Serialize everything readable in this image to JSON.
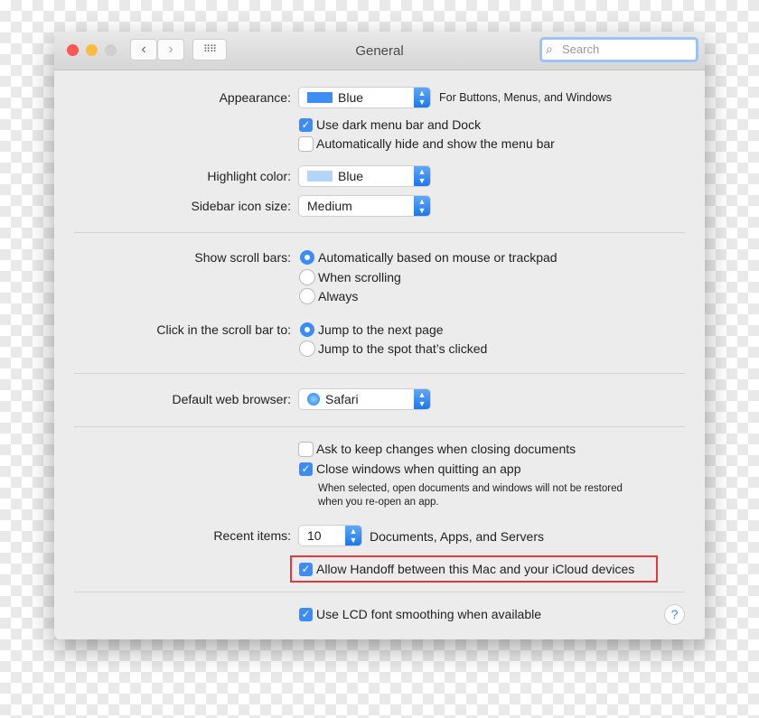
{
  "window": {
    "title": "General",
    "search_placeholder": "Search"
  },
  "appearance": {
    "label": "Appearance:",
    "value": "Blue",
    "swatch": "#3d8df4",
    "note": "For Buttons, Menus, and Windows"
  },
  "dark_menu": {
    "label": "Use dark menu bar and Dock",
    "checked": true
  },
  "auto_hide": {
    "label": "Automatically hide and show the menu bar",
    "checked": false
  },
  "highlight": {
    "label": "Highlight color:",
    "value": "Blue",
    "swatch": "#b5d4f9"
  },
  "sidebar_size": {
    "label": "Sidebar icon size:",
    "value": "Medium"
  },
  "scroll_bars": {
    "label": "Show scroll bars:",
    "options": [
      "Automatically based on mouse or trackpad",
      "When scrolling",
      "Always"
    ],
    "selected": 0
  },
  "click_scroll": {
    "label": "Click in the scroll bar to:",
    "options": [
      "Jump to the next page",
      "Jump to the spot that’s clicked"
    ],
    "selected": 0
  },
  "browser": {
    "label": "Default web browser:",
    "value": "Safari"
  },
  "ask_keep": {
    "label": "Ask to keep changes when closing documents",
    "checked": false
  },
  "close_windows": {
    "label": "Close windows when quitting an app",
    "checked": true
  },
  "note": [
    "When selected, open documents and windows will not be restored",
    "when you re-open an app."
  ],
  "recent": {
    "label": "Recent items:",
    "value": "10",
    "suffix": "Documents, Apps, and Servers"
  },
  "handoff": {
    "label": "Allow Handoff between this Mac and your iCloud devices",
    "checked": true,
    "highlight_color": "#e8373a"
  },
  "lcd": {
    "label": "Use LCD font smoothing when available",
    "checked": true
  },
  "help": "?"
}
